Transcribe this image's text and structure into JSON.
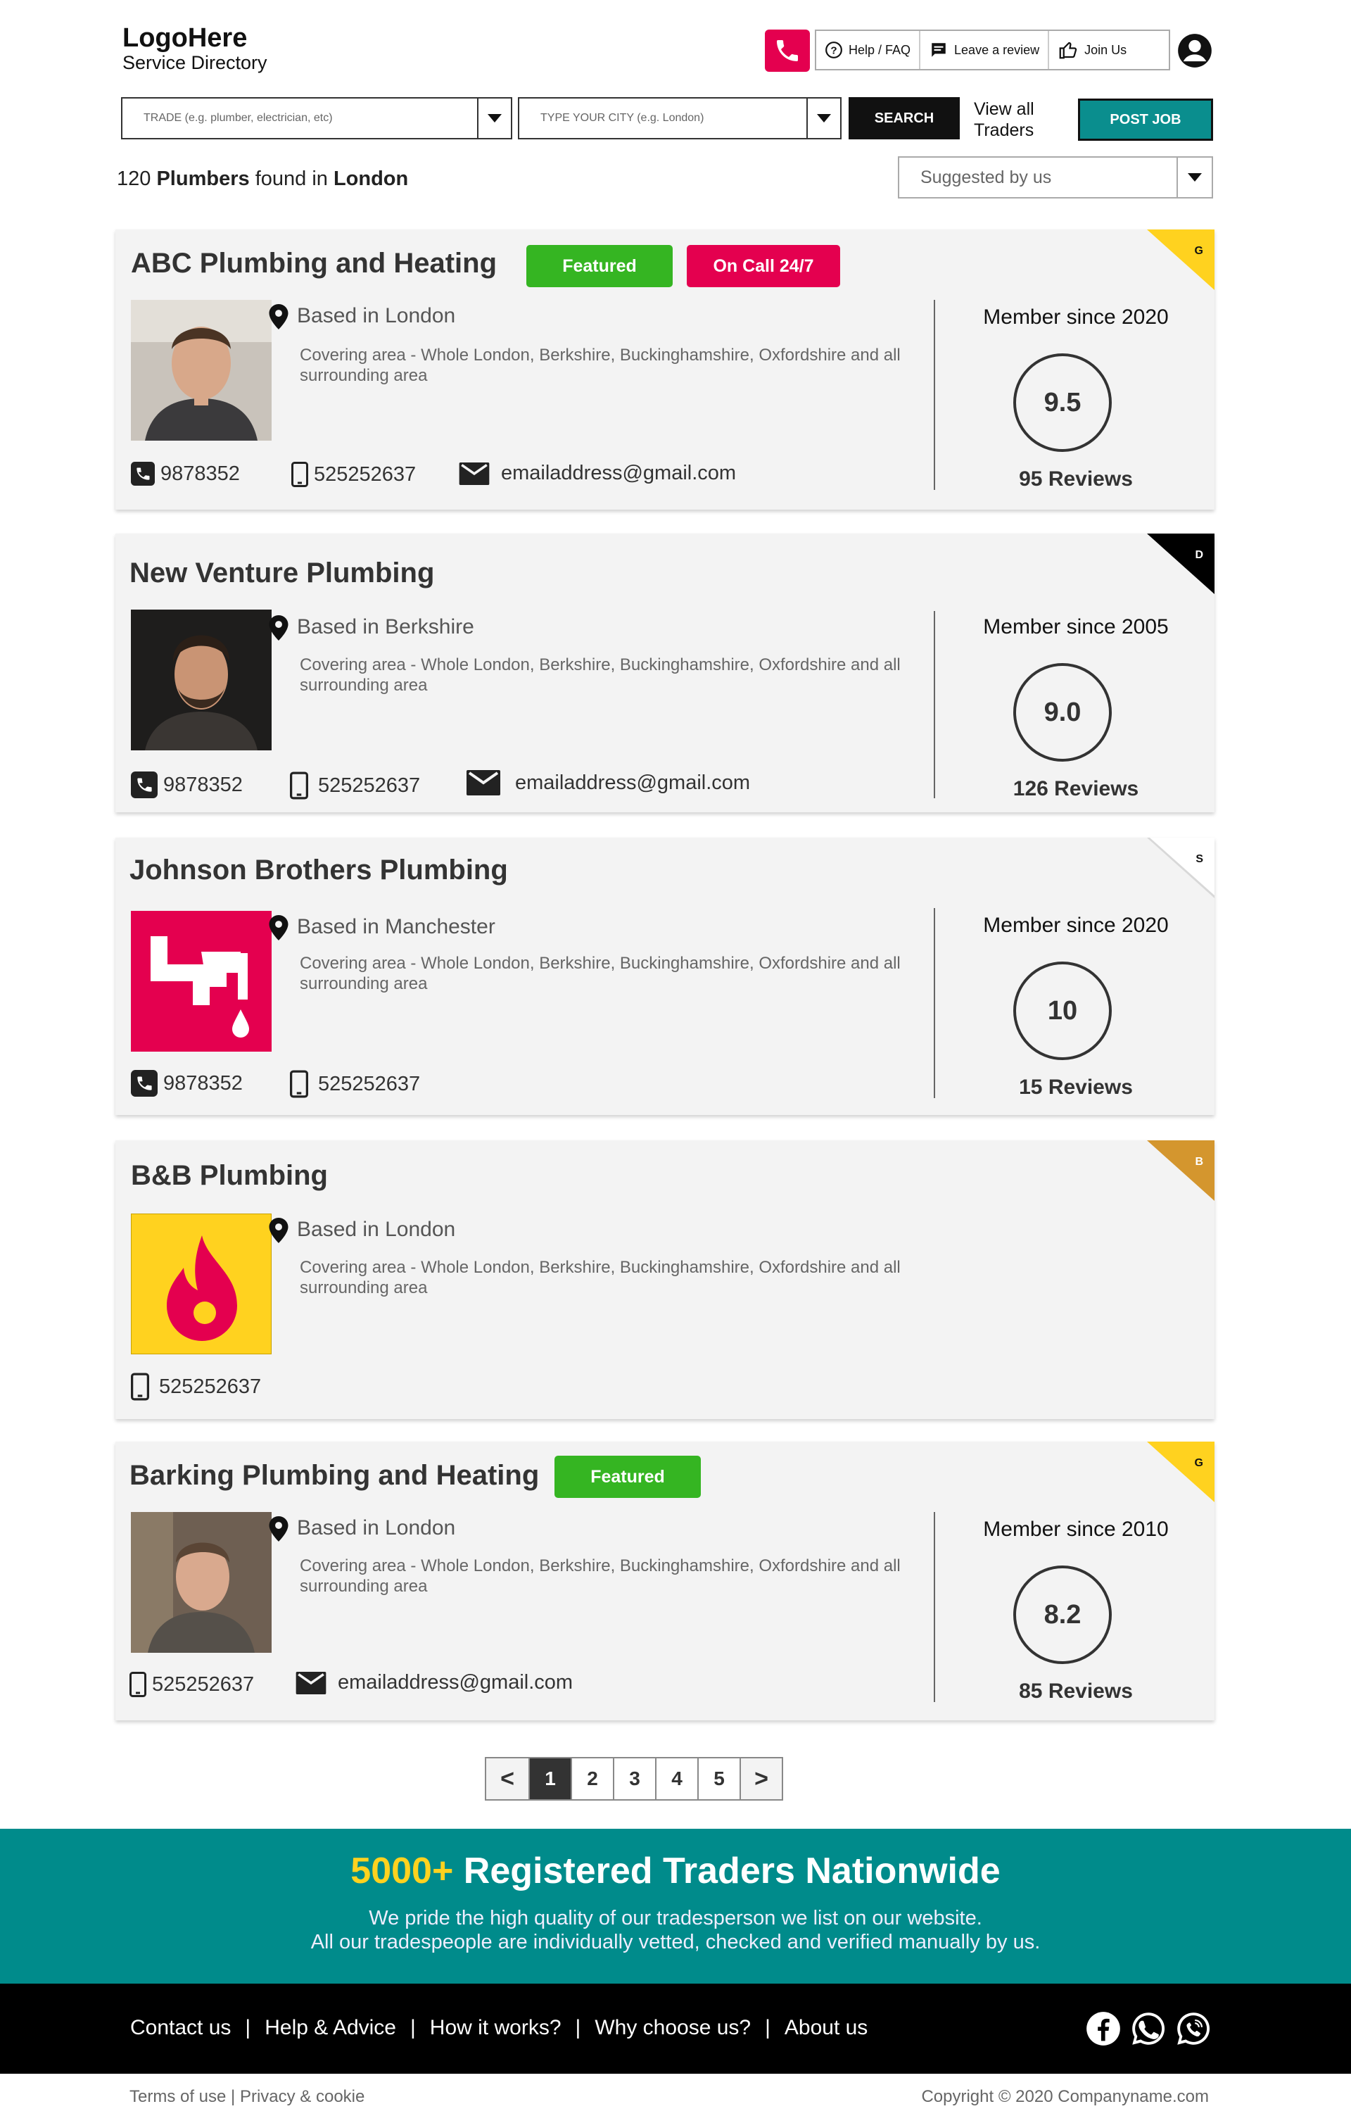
{
  "logo": {
    "line1": "LogoHere",
    "line2": "Service Directory"
  },
  "topnav": {
    "help": "Help / FAQ",
    "review": "Leave a review",
    "join": "Join Us"
  },
  "search": {
    "trade_placeholder": "TRADE (e.g. plumber, electrician, etc)",
    "city_placeholder": "TYPE YOUR CITY (e.g. London)",
    "search_label": "SEARCH",
    "view_all": "View all Traders",
    "post_job": "POST JOB"
  },
  "results": {
    "count": "120",
    "trade": "Plumbers",
    "found_in": "found in",
    "city": "London",
    "sort_value": "Suggested by us"
  },
  "listings": [
    {
      "name": "ABC Plumbing and Heating",
      "badges": [
        "Featured",
        "On Call 24/7"
      ],
      "tier": "G",
      "tier_color": "#ffd21f",
      "based": "Based in London",
      "covering": "Covering area - Whole London, Berkshire, Buckinghamshire, Oxfordshire and all surrounding area",
      "phone": "9878352",
      "mobile": "525252637",
      "email": "emailaddress@gmail.com",
      "member_since": "Member since 2020",
      "score": "9.5",
      "reviews": "95 Reviews"
    },
    {
      "name": "New Venture Plumbing",
      "tier": "D",
      "tier_color": "#000000",
      "based": "Based in Berkshire",
      "covering": "Covering area - Whole London, Berkshire, Buckinghamshire, Oxfordshire and all surrounding area",
      "phone": "9878352",
      "mobile": "525252637",
      "email": "emailaddress@gmail.com",
      "member_since": "Member since 2005",
      "score": "9.0",
      "reviews": "126 Reviews"
    },
    {
      "name": "Johnson Brothers Plumbing",
      "tier": "S",
      "tier_color": "#ffffff",
      "based": "Based in Manchester",
      "covering": "Covering area - Whole London, Berkshire, Buckinghamshire, Oxfordshire and all surrounding area",
      "phone": "9878352",
      "mobile": "525252637",
      "member_since": "Member since 2020",
      "score": "10",
      "reviews": "15 Reviews"
    },
    {
      "name": "B&B Plumbing",
      "tier": "B",
      "tier_color": "#d4962e",
      "based": "Based in London",
      "covering": "Covering area - Whole London, Berkshire, Buckinghamshire, Oxfordshire and all surrounding area",
      "mobile": "525252637"
    },
    {
      "name": "Barking Plumbing and Heating",
      "badges": [
        "Featured"
      ],
      "tier": "G",
      "tier_color": "#ffd21f",
      "based": "Based in London",
      "covering": "Covering area - Whole London, Berkshire, Buckinghamshire, Oxfordshire and all surrounding area",
      "mobile": "525252637",
      "email": "emailaddress@gmail.com",
      "member_since": "Member since 2010",
      "score": "8.2",
      "reviews": "85 Reviews"
    }
  ],
  "pagination": {
    "prev": "<",
    "pages": [
      "1",
      "2",
      "3",
      "4",
      "5"
    ],
    "current": "1",
    "next": ">"
  },
  "banner": {
    "number": "5000+",
    "headline": "Registered Traders Nationwide",
    "line1": "We pride the high quality of our tradesperson we list on our website.",
    "line2": "All our tradespeople are individually vetted, checked and verified manually by us."
  },
  "footer": {
    "links": [
      "Contact us",
      "Help & Advice",
      "How it works?",
      "Why choose us?",
      "About us"
    ],
    "social_icons": [
      "facebook-icon",
      "whatsapp-icon",
      "viber-icon"
    ],
    "legal": "Terms of use | Privacy & cookie",
    "copyright": "Copyright © 2020 Companyname.com"
  },
  "colors": {
    "accent_red": "#e4004f",
    "teal": "#008b8b",
    "featured_green": "#35b522",
    "gold": "#ffd21f"
  }
}
